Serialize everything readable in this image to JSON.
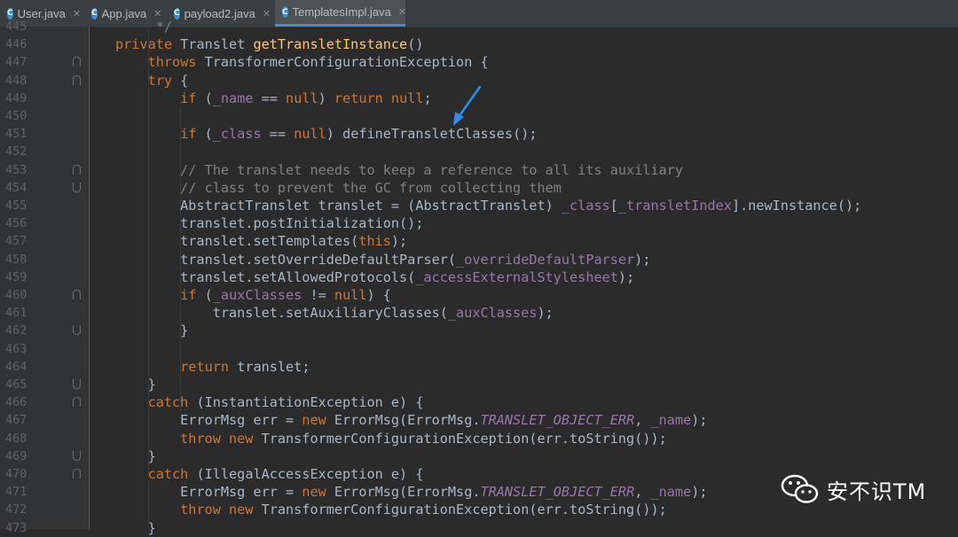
{
  "tabs": [
    {
      "label": "User.java",
      "icon": "C",
      "color": "#3d8fd1",
      "active": false
    },
    {
      "label": "App.java",
      "icon": "C",
      "color": "#3d8fd1",
      "active": false
    },
    {
      "label": "payload2.java",
      "icon": "C",
      "color": "#3d8fd1",
      "active": false
    },
    {
      "label": "TemplatesImpl.java",
      "icon": "C",
      "color": "#3d8fd1",
      "active": true
    }
  ],
  "watermark": {
    "text": "安不识TM",
    "icon": "wechat-icon"
  },
  "code": {
    "lines": [
      {
        "n": "445",
        "fold": "",
        "tokens": [
          [
            "cmt",
            "     */"
          ]
        ]
      },
      {
        "n": "446",
        "fold": "",
        "tokens": [
          [
            "kw",
            "private "
          ],
          [
            "txt",
            "Translet "
          ],
          [
            "fn",
            "getTransletInstance"
          ],
          [
            "txt",
            "()"
          ]
        ]
      },
      {
        "n": "447",
        "fold": "start",
        "tokens": [
          [
            "txt",
            "    "
          ],
          [
            "kw",
            "throws "
          ],
          [
            "txt",
            "TransformerConfigurationException {"
          ]
        ]
      },
      {
        "n": "448",
        "fold": "start",
        "tokens": [
          [
            "txt",
            "    "
          ],
          [
            "kw",
            "try "
          ],
          [
            "txt",
            "{"
          ]
        ]
      },
      {
        "n": "449",
        "fold": "",
        "tokens": [
          [
            "txt",
            "        "
          ],
          [
            "kw",
            "if "
          ],
          [
            "txt",
            "("
          ],
          [
            "fld",
            "_name"
          ],
          [
            "txt",
            " == "
          ],
          [
            "kw",
            "null"
          ],
          [
            "txt",
            ") "
          ],
          [
            "kw",
            "return null"
          ],
          [
            "txt",
            ";"
          ]
        ]
      },
      {
        "n": "450",
        "fold": "",
        "tokens": []
      },
      {
        "n": "451",
        "fold": "",
        "tokens": [
          [
            "txt",
            "        "
          ],
          [
            "kw",
            "if "
          ],
          [
            "txt",
            "("
          ],
          [
            "fld",
            "_class"
          ],
          [
            "txt",
            " == "
          ],
          [
            "kw",
            "null"
          ],
          [
            "txt",
            ") defineTransletClasses();"
          ]
        ]
      },
      {
        "n": "452",
        "fold": "",
        "tokens": []
      },
      {
        "n": "453",
        "fold": "start",
        "tokens": [
          [
            "txt",
            "        "
          ],
          [
            "cmt",
            "// The translet needs to keep a reference to all its auxiliary"
          ]
        ]
      },
      {
        "n": "454",
        "fold": "end",
        "tokens": [
          [
            "txt",
            "        "
          ],
          [
            "cmt",
            "// class to prevent the GC from collecting them"
          ]
        ]
      },
      {
        "n": "455",
        "fold": "",
        "tokens": [
          [
            "txt",
            "        AbstractTranslet translet = (AbstractTranslet) "
          ],
          [
            "fld",
            "_class"
          ],
          [
            "txt",
            "["
          ],
          [
            "fld",
            "_transletIndex"
          ],
          [
            "txt",
            "].newInstance();"
          ]
        ]
      },
      {
        "n": "456",
        "fold": "",
        "tokens": [
          [
            "txt",
            "        translet.postInitialization();"
          ]
        ]
      },
      {
        "n": "457",
        "fold": "",
        "tokens": [
          [
            "txt",
            "        translet.setTemplates("
          ],
          [
            "kw",
            "this"
          ],
          [
            "txt",
            ");"
          ]
        ]
      },
      {
        "n": "458",
        "fold": "",
        "tokens": [
          [
            "txt",
            "        translet.setOverrideDefaultParser("
          ],
          [
            "fld",
            "_overrideDefaultParser"
          ],
          [
            "txt",
            ");"
          ]
        ]
      },
      {
        "n": "459",
        "fold": "",
        "tokens": [
          [
            "txt",
            "        translet.setAllowedProtocols("
          ],
          [
            "fld",
            "_accessExternalStylesheet"
          ],
          [
            "txt",
            ");"
          ]
        ]
      },
      {
        "n": "460",
        "fold": "start",
        "tokens": [
          [
            "txt",
            "        "
          ],
          [
            "kw",
            "if "
          ],
          [
            "txt",
            "("
          ],
          [
            "fld",
            "_auxClasses"
          ],
          [
            "txt",
            " != "
          ],
          [
            "kw",
            "null"
          ],
          [
            "txt",
            ") {"
          ]
        ]
      },
      {
        "n": "461",
        "fold": "",
        "tokens": [
          [
            "txt",
            "            translet.setAuxiliaryClasses("
          ],
          [
            "fld",
            "_auxClasses"
          ],
          [
            "txt",
            ");"
          ]
        ]
      },
      {
        "n": "462",
        "fold": "end",
        "tokens": [
          [
            "txt",
            "        }"
          ]
        ]
      },
      {
        "n": "463",
        "fold": "",
        "tokens": []
      },
      {
        "n": "464",
        "fold": "",
        "tokens": [
          [
            "txt",
            "        "
          ],
          [
            "kw",
            "return "
          ],
          [
            "txt",
            "translet;"
          ]
        ]
      },
      {
        "n": "465",
        "fold": "end",
        "tokens": [
          [
            "txt",
            "    }"
          ]
        ]
      },
      {
        "n": "466",
        "fold": "start",
        "tokens": [
          [
            "txt",
            "    "
          ],
          [
            "kw",
            "catch "
          ],
          [
            "txt",
            "(InstantiationException e) {"
          ]
        ]
      },
      {
        "n": "467",
        "fold": "",
        "tokens": [
          [
            "txt",
            "        ErrorMsg err = "
          ],
          [
            "kw",
            "new "
          ],
          [
            "txt",
            "ErrorMsg(ErrorMsg."
          ],
          [
            "fldi",
            "TRANSLET_OBJECT_ERR"
          ],
          [
            "txt",
            ", "
          ],
          [
            "fld",
            "_name"
          ],
          [
            "txt",
            ");"
          ]
        ]
      },
      {
        "n": "468",
        "fold": "",
        "tokens": [
          [
            "txt",
            "        "
          ],
          [
            "kw",
            "throw new "
          ],
          [
            "txt",
            "TransformerConfigurationException(err.toString());"
          ]
        ]
      },
      {
        "n": "469",
        "fold": "end",
        "tokens": [
          [
            "txt",
            "    }"
          ]
        ]
      },
      {
        "n": "470",
        "fold": "start",
        "tokens": [
          [
            "txt",
            "    "
          ],
          [
            "kw",
            "catch "
          ],
          [
            "txt",
            "(IllegalAccessException e) {"
          ]
        ]
      },
      {
        "n": "471",
        "fold": "",
        "tokens": [
          [
            "txt",
            "        ErrorMsg err = "
          ],
          [
            "kw",
            "new "
          ],
          [
            "txt",
            "ErrorMsg(ErrorMsg."
          ],
          [
            "fldi",
            "TRANSLET_OBJECT_ERR"
          ],
          [
            "txt",
            ", "
          ],
          [
            "fld",
            "_name"
          ],
          [
            "txt",
            ");"
          ]
        ]
      },
      {
        "n": "472",
        "fold": "",
        "tokens": [
          [
            "txt",
            "        "
          ],
          [
            "kw",
            "throw new "
          ],
          [
            "txt",
            "TransformerConfigurationException(err.toString());"
          ]
        ]
      },
      {
        "n": "473",
        "fold": "",
        "tokens": [
          [
            "txt",
            "    }"
          ]
        ]
      }
    ]
  }
}
